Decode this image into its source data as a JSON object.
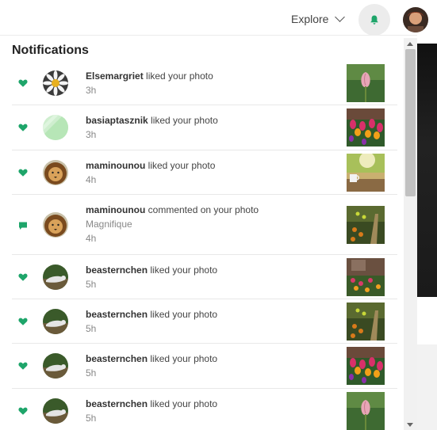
{
  "header": {
    "explore_label": "Explore",
    "bell_icon": "bell-icon",
    "accent_color": "#1ea56a"
  },
  "panel": {
    "title": "Notifications"
  },
  "notifications": [
    {
      "user": "Elsemargriet",
      "action": "liked your photo",
      "comment": "",
      "time": "3h",
      "kind": "heart-icon"
    },
    {
      "user": "basiaptasznik",
      "action": "liked your photo",
      "comment": "",
      "time": "3h",
      "kind": "heart-icon"
    },
    {
      "user": "maminounou",
      "action": "liked your photo",
      "comment": "",
      "time": "4h",
      "kind": "heart-icon"
    },
    {
      "user": "maminounou",
      "action": "commented on your photo",
      "comment": "Magnifique",
      "time": "4h",
      "kind": "comment-icon"
    },
    {
      "user": "beasternchen",
      "action": "liked your photo",
      "comment": "",
      "time": "5h",
      "kind": "heart-icon"
    },
    {
      "user": "beasternchen",
      "action": "liked your photo",
      "comment": "",
      "time": "5h",
      "kind": "heart-icon"
    },
    {
      "user": "beasternchen",
      "action": "liked your photo",
      "comment": "",
      "time": "5h",
      "kind": "heart-icon"
    },
    {
      "user": "beasternchen",
      "action": "liked your photo",
      "comment": "",
      "time": "5h",
      "kind": "heart-icon"
    }
  ]
}
